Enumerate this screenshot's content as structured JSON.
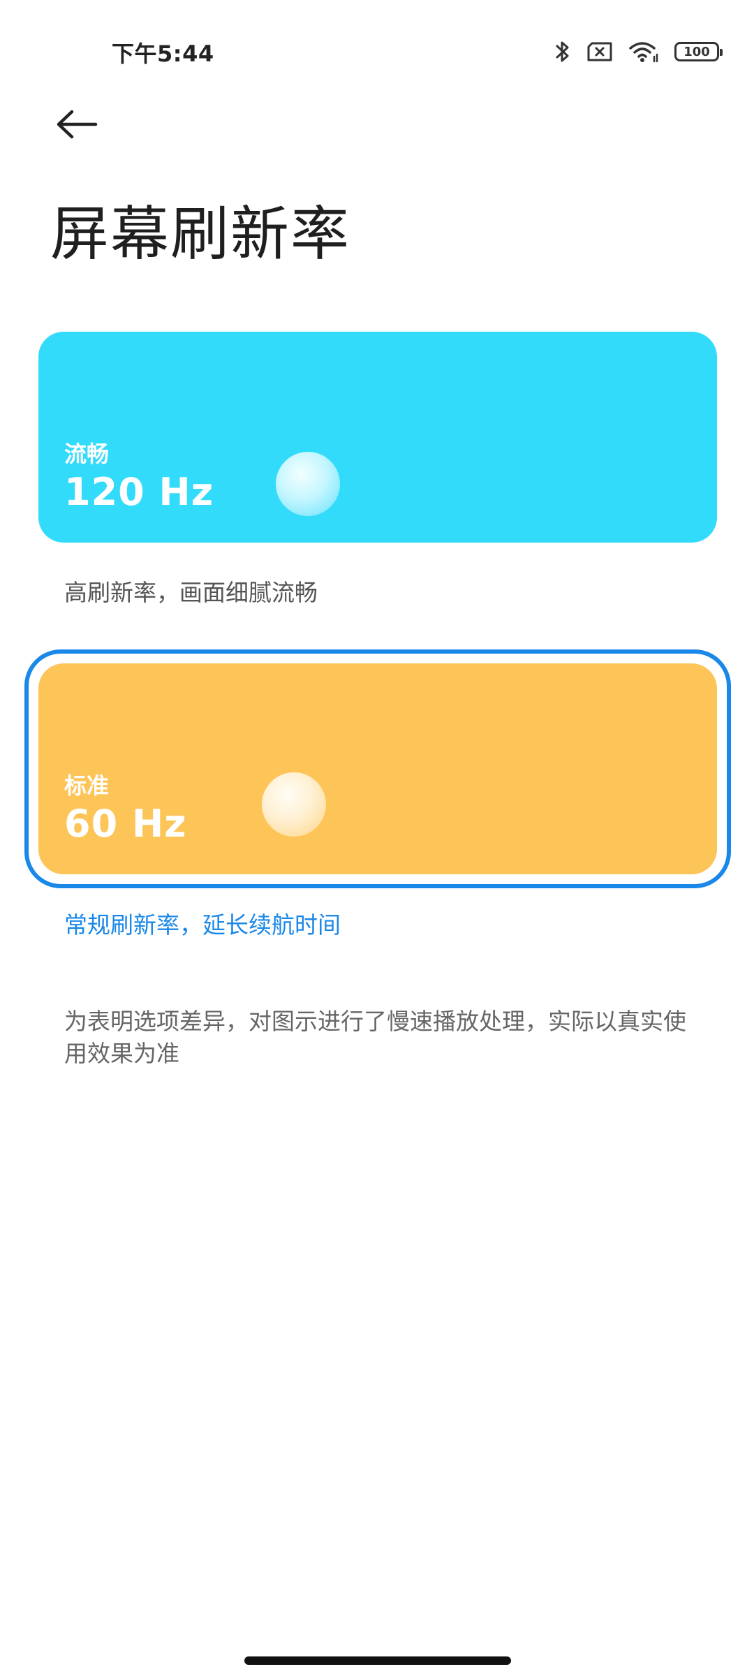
{
  "status_bar": {
    "time": "下午5:44",
    "battery": "100",
    "icons": [
      "bluetooth-icon",
      "sim-x-icon",
      "wifi-icon",
      "battery-icon"
    ]
  },
  "header": {
    "back_icon": "arrow-left-icon",
    "title": "屏幕刷新率"
  },
  "options": [
    {
      "mode": "流畅",
      "rate": "120 Hz",
      "description": "高刷新率，画面细腻流畅",
      "color": "#33dbfb",
      "selected": false
    },
    {
      "mode": "标准",
      "rate": "60 Hz",
      "description": "常规刷新率，延长续航时间",
      "color": "#fdc458",
      "selected": true
    }
  ],
  "note": "为表明选项差异，对图示进行了慢速播放处理，实际以真实使用效果为准",
  "colors": {
    "accent": "#1a88e8"
  }
}
